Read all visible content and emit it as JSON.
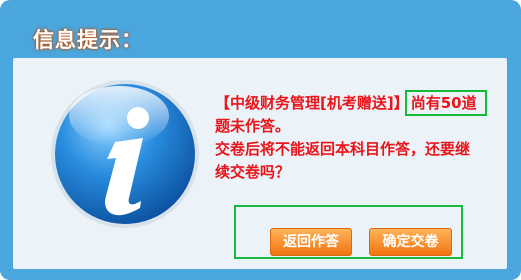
{
  "dialog": {
    "title": "信息提示：",
    "message": {
      "exam_name": "【中级财务管理[机考赠送]】",
      "remaining": "尚有50道",
      "line2": "题未作答。",
      "line3": "交卷后将不能返回本科目作答，还要继",
      "line4": "续交卷吗？"
    },
    "buttons": {
      "back_label": "返回作答",
      "submit_label": "确定交卷"
    }
  },
  "colors": {
    "frame": "#4aa6dc",
    "panel": "#ecf3f8",
    "message_text": "#e8151b",
    "highlight_box": "#15b93b",
    "button": "#f27410"
  },
  "icons": [
    "info-icon"
  ]
}
